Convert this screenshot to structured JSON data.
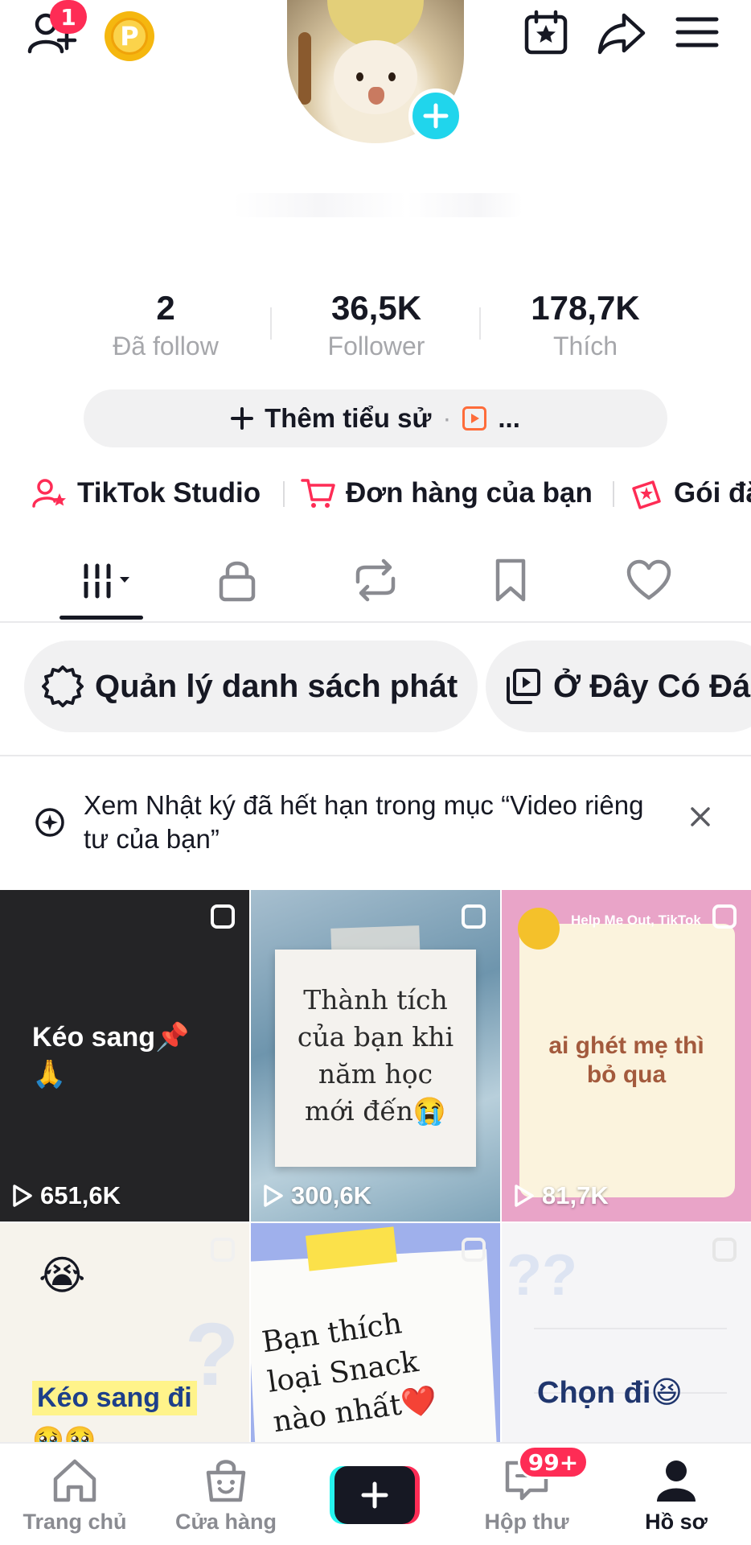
{
  "header": {
    "friend_badge": "1",
    "coin_letter": "P"
  },
  "stats": [
    {
      "value": "2",
      "label": "Đã follow"
    },
    {
      "value": "36,5K",
      "label": "Follower"
    },
    {
      "value": "178,7K",
      "label": "Thích"
    }
  ],
  "bio": {
    "add_bio": "Thêm tiểu sử",
    "dot": "·",
    "more": "..."
  },
  "shortcuts": [
    {
      "label": "TikTok Studio"
    },
    {
      "label": "Đơn hàng của bạn"
    },
    {
      "label": "Gói đă"
    }
  ],
  "chips": [
    {
      "label": "Quản lý danh sách phát"
    },
    {
      "label": "Ở Đây Có Đá"
    }
  ],
  "notice": {
    "text": "Xem Nhật ký đã hết hạn trong mục “Video riêng tư của bạn”"
  },
  "videos": [
    {
      "caption": "Kéo sang📌 🙏",
      "views": "651,6K"
    },
    {
      "caption": "Thành tích của bạn khi năm học mới đến😭",
      "views": "300,6K"
    },
    {
      "caption": "ai ghét mẹ thì bỏ qua",
      "header": "Help  Me Out, TikTok",
      "views": "81,7K"
    },
    {
      "emoji": "😭",
      "caption": "Kéo sang đi",
      "caption2": "🥹🥹"
    },
    {
      "caption": "Bạn thích loại Snack nào nhất❤️"
    },
    {
      "caption": "Chọn đi😆"
    }
  ],
  "nav": [
    {
      "label": "Trang chủ"
    },
    {
      "label": "Cửa hàng"
    },
    {
      "label": ""
    },
    {
      "label": "Hộp thư",
      "badge": "99+"
    },
    {
      "label": "Hồ sơ"
    }
  ],
  "colors": {
    "accent": "#fe2c55",
    "cyan": "#20d5ec",
    "text": "#161823",
    "muted": "#a6a7ab"
  }
}
